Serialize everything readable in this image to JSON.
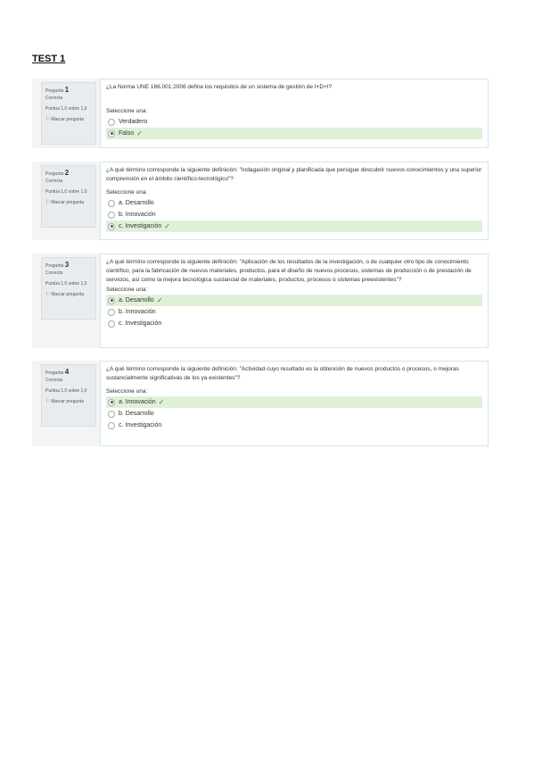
{
  "page": {
    "title": "TEST 1"
  },
  "questions": [
    {
      "number_prefix": "Pregunta",
      "number": "1",
      "status": "Correcta",
      "score": "Puntúa 1,0 sobre 1,0",
      "flag_label": "Marcar pregunta",
      "text": "¿La Norma UNE 166.001:2006 define los requisitos de un sistema de gestión de I+D+I?",
      "prompt": "Seleccione una:",
      "options": [
        {
          "label": "Verdadero",
          "selected": false,
          "correct": false
        },
        {
          "label": "Falso",
          "selected": true,
          "correct": true
        }
      ]
    },
    {
      "number_prefix": "Pregunta",
      "number": "2",
      "status": "Correcta",
      "score": "Puntúa 1,0 sobre 1,0",
      "flag_label": "Marcar pregunta",
      "text": "¿A qué término corresponde la siguiente definición: \"Indagación original y planificada que persigue descubrir nuevos conocimientos y una superior comprensión en el ámbito científico-tecnológico\"?",
      "prompt": "Seleccione una:",
      "options": [
        {
          "label": "a. Desarrollo",
          "selected": false,
          "correct": false
        },
        {
          "label": "b. Innovación",
          "selected": false,
          "correct": false
        },
        {
          "label": "c. Investigación",
          "selected": true,
          "correct": true
        }
      ]
    },
    {
      "number_prefix": "Pregunta",
      "number": "3",
      "status": "Correcta",
      "score": "Puntúa 1,0 sobre 1,0",
      "flag_label": "Marcar pregunta",
      "text": "¿A qué término corresponde la siguiente definición: \"Aplicación de los resultados de la investigación, o de cualquier otro tipo de conocimiento científico, para la fabricación de nuevos materiales, productos, para el diseño de nuevos procesos, sistemas de producción o de prestación de servicios, así como la mejora tecnológica sustancial de materiales, productos, procesos o sistemas preexistentes\"?",
      "prompt": "Seleccione una:",
      "options": [
        {
          "label": "a. Desarrollo",
          "selected": true,
          "correct": true
        },
        {
          "label": "b. Innovación",
          "selected": false,
          "correct": false
        },
        {
          "label": "c. Investigación",
          "selected": false,
          "correct": false
        }
      ]
    },
    {
      "number_prefix": "Pregunta",
      "number": "4",
      "status": "Correcta",
      "score": "Puntúa 1,0 sobre 1,0",
      "flag_label": "Marcar pregunta",
      "text": "¿A qué término corresponde la siguiente definición: \"Actividad cuyo resultado es la obtención de nuevos productos o procesos, o mejoras sustancialmente significativas de los ya existentes\"?",
      "prompt": "Seleccione una:",
      "options": [
        {
          "label": "a. Innovación",
          "selected": true,
          "correct": true
        },
        {
          "label": "b. Desarrollo",
          "selected": false,
          "correct": false
        },
        {
          "label": "c. Investigación",
          "selected": false,
          "correct": false
        }
      ]
    }
  ]
}
